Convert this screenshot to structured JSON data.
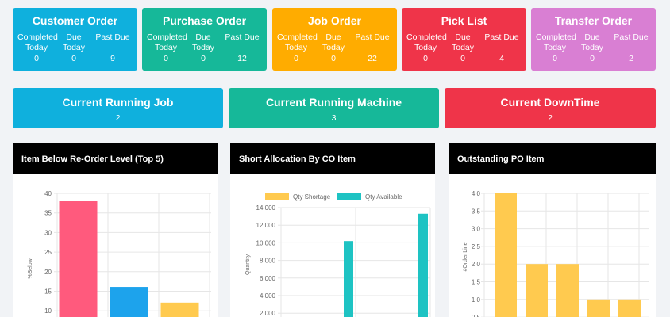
{
  "colors": {
    "customer_order": "#0fb0dd",
    "purchase_order": "#16b899",
    "job_order": "#ffac00",
    "pick_list": "#ef3449",
    "transfer_order": "#d97fd3",
    "running_job": "#0fb0dd",
    "running_machine": "#16b899",
    "downtime": "#ef3449"
  },
  "stat_cards": [
    {
      "title": "Customer Order",
      "completed_label": "Completed\nToday",
      "due_label": "Due\nToday",
      "pastdue_label": "Past Due",
      "completed": "0",
      "due": "0",
      "pastdue": "9"
    },
    {
      "title": "Purchase Order",
      "completed_label": "Completed\nToday",
      "due_label": "Due\nToday",
      "pastdue_label": "Past Due",
      "completed": "0",
      "due": "0",
      "pastdue": "12"
    },
    {
      "title": "Job Order",
      "completed_label": "Completed\nToday",
      "due_label": "Due\nToday",
      "pastdue_label": "Past Due",
      "completed": "0",
      "due": "0",
      "pastdue": "22"
    },
    {
      "title": "Pick List",
      "completed_label": "Completed\nToday",
      "due_label": "Due\nToday",
      "pastdue_label": "Past Due",
      "completed": "0",
      "due": "0",
      "pastdue": "4"
    },
    {
      "title": "Transfer Order",
      "completed_label": "Completed\nToday",
      "due_label": "Due\nToday",
      "pastdue_label": "Past Due",
      "completed": "0",
      "due": "0",
      "pastdue": "2"
    }
  ],
  "summary_cards": [
    {
      "title": "Current Running Job",
      "value": "2"
    },
    {
      "title": "Current Running Machine",
      "value": "3"
    },
    {
      "title": "Current DownTime",
      "value": "2"
    }
  ],
  "chart_data": [
    {
      "type": "bar",
      "title": "Item Below Re-Order Level (Top 5)",
      "ylabel": "%Below",
      "xlabel": "",
      "ylim": [
        10,
        40
      ],
      "yticks": [
        "40",
        "35",
        "30",
        "25",
        "20",
        "15",
        "10"
      ],
      "values": [
        38,
        16,
        12
      ],
      "colors": [
        "#ff5a7d",
        "#1da3ec",
        "#ffca4f"
      ],
      "grid": true
    },
    {
      "type": "bar",
      "title": "Short Allocation By CO Item",
      "ylabel": "Quantity",
      "xlabel": "",
      "ylim": [
        2000,
        14000
      ],
      "yticks": [
        "14,000",
        "12,000",
        "10,000",
        "8,000",
        "6,000",
        "4,000",
        "2,000"
      ],
      "legend": "top",
      "series": [
        {
          "name": "Qty Shortage",
          "color": "#ffca4f",
          "values": [
            0,
            0
          ]
        },
        {
          "name": "Qty Available",
          "color": "#1ec3c3",
          "values": [
            10200,
            13300
          ]
        }
      ],
      "grid": true
    },
    {
      "type": "bar",
      "title": "Outstanding PO Item",
      "ylabel": "#Order Line",
      "xlabel": "",
      "ylim": [
        0.5,
        4.0
      ],
      "yticks": [
        "4.0",
        "3.5",
        "3.0",
        "2.5",
        "2.0",
        "1.5",
        "1.0",
        "0.5"
      ],
      "values": [
        4,
        2,
        2,
        1,
        1
      ],
      "colors": [
        "#ffca4f",
        "#ffca4f",
        "#ffca4f",
        "#ffca4f",
        "#ffca4f"
      ],
      "grid": true
    }
  ]
}
